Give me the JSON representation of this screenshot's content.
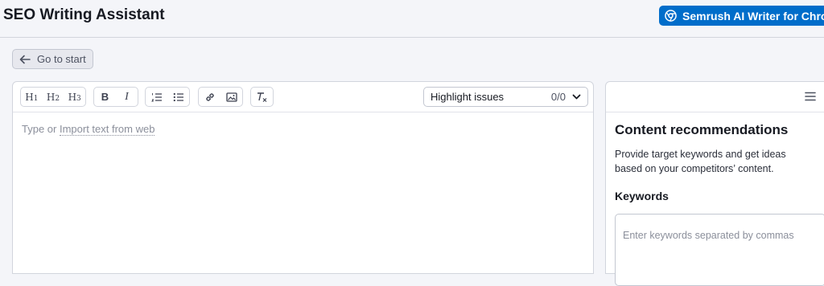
{
  "header": {
    "title": "SEO Writing Assistant",
    "extension_button": "Semrush AI Writer for Chrome",
    "extension_icon": "chrome-icon"
  },
  "back_button": {
    "label": "Go to start",
    "icon": "arrow-left-icon"
  },
  "toolbar": {
    "headings": [
      {
        "label": "H",
        "level": "1"
      },
      {
        "label": "H",
        "level": "2"
      },
      {
        "label": "H",
        "level": "3"
      }
    ],
    "format_icons": [
      "bold-icon",
      "italic-icon"
    ],
    "list_icons": [
      "ordered-list-icon",
      "bullet-list-icon"
    ],
    "insert_icons": [
      "link-icon",
      "image-icon"
    ],
    "clear_icon": "clear-format-icon",
    "bold_glyph": "B",
    "italic_glyph": "I",
    "highlight": {
      "label": "Highlight issues",
      "count": "0/0"
    }
  },
  "editor": {
    "placeholder_prefix": "Type or ",
    "import_link": "Import text from web"
  },
  "panel": {
    "title": "Content recommendations",
    "description": "Provide target keywords and get ideas based on your competitors’ content.",
    "keywords_label": "Keywords",
    "keywords_placeholder": "Enter keywords separated by commas"
  }
}
